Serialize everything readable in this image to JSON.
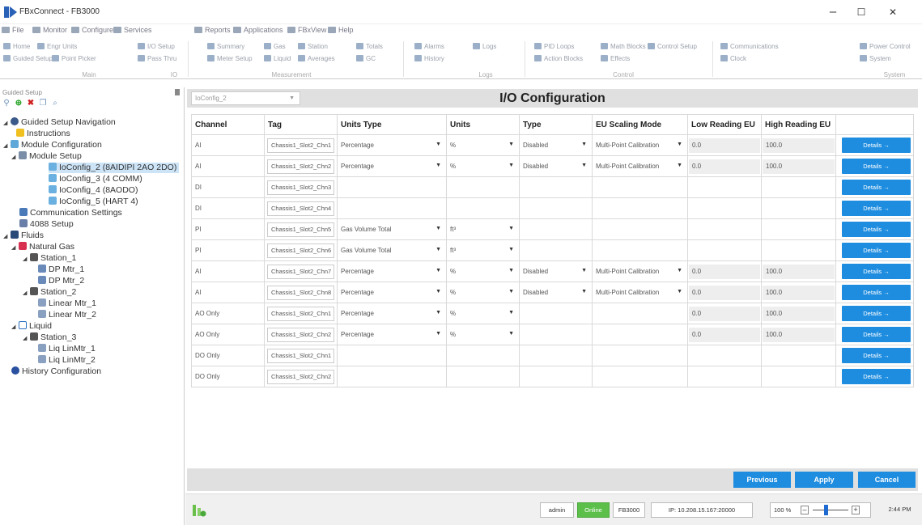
{
  "window": {
    "title": "FBxConnect - FB3000",
    "minimize": "–",
    "maximize": "☐",
    "close": "✕"
  },
  "menu": [
    "File",
    "Monitor",
    "Configure",
    "Services",
    "Reports",
    "Applications",
    "FBxView",
    "Help"
  ],
  "ribbon": {
    "buttons": [
      "Home",
      "Engr Units",
      "I/O Setup",
      "Summary",
      "Gas",
      "Station",
      "Totals",
      "Alarms",
      "Logs",
      "PID Loops",
      "Math Blocks",
      "Control Setup",
      "Communications",
      "Power Control",
      "Guided Setup",
      "Point Picker",
      "Pass Thru",
      "Meter Setup",
      "Liquid",
      "Averages",
      "GC",
      "History",
      "Action Blocks",
      "Effects",
      "Clock",
      "System"
    ],
    "groups": [
      "Main",
      "IO",
      "Measurement",
      "Logs",
      "Control",
      "System"
    ]
  },
  "left_panel": {
    "title": "Guided Setup",
    "tree": [
      {
        "label": "Guided Setup Navigation",
        "icon": "gear-icon"
      },
      {
        "label": "Instructions",
        "icon": "lightbulb-icon"
      },
      {
        "label": "Module Configuration",
        "icon": "module-icon"
      },
      {
        "label": "Module Setup",
        "icon": "list-icon"
      },
      {
        "label": "IoConfig_2 (8AIDIPI 2AO 2DO)",
        "icon": "io-icon"
      },
      {
        "label": "IoConfig_3 (4 COMM)",
        "icon": "io-icon"
      },
      {
        "label": "IoConfig_4 (8AODO)",
        "icon": "io-icon"
      },
      {
        "label": "IoConfig_5 (HART 4)",
        "icon": "io-icon"
      },
      {
        "label": "Communication Settings",
        "icon": "comm-icon"
      },
      {
        "label": "4088 Setup",
        "icon": "transmitter-icon"
      },
      {
        "label": "Fluids",
        "icon": "fluids-icon"
      },
      {
        "label": "Natural Gas",
        "icon": "gas-icon"
      },
      {
        "label": "Station_1",
        "icon": "station-icon"
      },
      {
        "label": "DP Mtr_1",
        "icon": "dp-meter-icon"
      },
      {
        "label": "DP Mtr_2",
        "icon": "dp-meter-icon"
      },
      {
        "label": "Station_2",
        "icon": "station-icon"
      },
      {
        "label": "Linear Mtr_1",
        "icon": "linear-meter-icon"
      },
      {
        "label": "Linear Mtr_2",
        "icon": "linear-meter-icon"
      },
      {
        "label": "Liquid",
        "icon": "liquid-icon"
      },
      {
        "label": "Station_3",
        "icon": "station-icon"
      },
      {
        "label": "Liq LinMtr_1",
        "icon": "linear-meter-icon"
      },
      {
        "label": "Liq LinMtr_2",
        "icon": "linear-meter-icon"
      },
      {
        "label": "History Configuration",
        "icon": "history-icon"
      }
    ]
  },
  "main": {
    "config_select": "IoConfig_2",
    "title": "I/O Configuration",
    "columns": [
      "Channel",
      "Tag",
      "Units Type",
      "Units",
      "Type",
      "EU Scaling Mode",
      "Low Reading EU",
      "High Reading EU",
      ""
    ],
    "details_label": "Details →",
    "rows": [
      {
        "channel": "AI",
        "tag": "Chassis1_Slot2_Chn1",
        "units_type": "Percentage",
        "units": "%",
        "type": "Disabled",
        "eu_mode": "Multi-Point Calibration",
        "low": "0.0",
        "high": "100.0"
      },
      {
        "channel": "AI",
        "tag": "Chassis1_Slot2_Chn2",
        "units_type": "Percentage",
        "units": "%",
        "type": "Disabled",
        "eu_mode": "Multi-Point Calibration",
        "low": "0.0",
        "high": "100.0"
      },
      {
        "channel": "DI",
        "tag": "Chassis1_Slot2_Chn3",
        "units_type": "",
        "units": "",
        "type": "",
        "eu_mode": "",
        "low": "",
        "high": ""
      },
      {
        "channel": "DI",
        "tag": "Chassis1_Slot2_Chn4",
        "units_type": "",
        "units": "",
        "type": "",
        "eu_mode": "",
        "low": "",
        "high": ""
      },
      {
        "channel": "PI",
        "tag": "Chassis1_Slot2_Chn5",
        "units_type": "Gas Volume Total",
        "units": "ft³",
        "type": "",
        "eu_mode": "",
        "low": "",
        "high": ""
      },
      {
        "channel": "PI",
        "tag": "Chassis1_Slot2_Chn6",
        "units_type": "Gas Volume Total",
        "units": "ft³",
        "type": "",
        "eu_mode": "",
        "low": "",
        "high": ""
      },
      {
        "channel": "AI",
        "tag": "Chassis1_Slot2_Chn7",
        "units_type": "Percentage",
        "units": "%",
        "type": "Disabled",
        "eu_mode": "Multi-Point Calibration",
        "low": "0.0",
        "high": "100.0"
      },
      {
        "channel": "AI",
        "tag": "Chassis1_Slot2_Chn8",
        "units_type": "Percentage",
        "units": "%",
        "type": "Disabled",
        "eu_mode": "Multi-Point Calibration",
        "low": "0.0",
        "high": "100.0"
      },
      {
        "channel": "AO Only",
        "tag": "Chassis1_Slot2_Chn1",
        "units_type": "Percentage",
        "units": "%",
        "type": "",
        "eu_mode": "",
        "low": "0.0",
        "high": "100.0"
      },
      {
        "channel": "AO Only",
        "tag": "Chassis1_Slot2_Chn2",
        "units_type": "Percentage",
        "units": "%",
        "type": "",
        "eu_mode": "",
        "low": "0.0",
        "high": "100.0"
      },
      {
        "channel": "DO Only",
        "tag": "Chassis1_Slot2_Chn1",
        "units_type": "",
        "units": "",
        "type": "",
        "eu_mode": "",
        "low": "",
        "high": ""
      },
      {
        "channel": "DO Only",
        "tag": "Chassis1_Slot2_Chn2",
        "units_type": "",
        "units": "",
        "type": "",
        "eu_mode": "",
        "low": "",
        "high": ""
      }
    ],
    "buttons": {
      "previous": "Previous",
      "apply": "Apply",
      "cancel": "Cancel"
    }
  },
  "status": {
    "user": "admin",
    "connection": "Online",
    "device": "FB3000",
    "ip": "IP: 10.208.15.167:20000",
    "zoom": "100 %",
    "time": "2:44 PM"
  },
  "colors": {
    "accent": "#1e8de0",
    "online": "#5cbf4a",
    "selected": "#cde4f7"
  }
}
